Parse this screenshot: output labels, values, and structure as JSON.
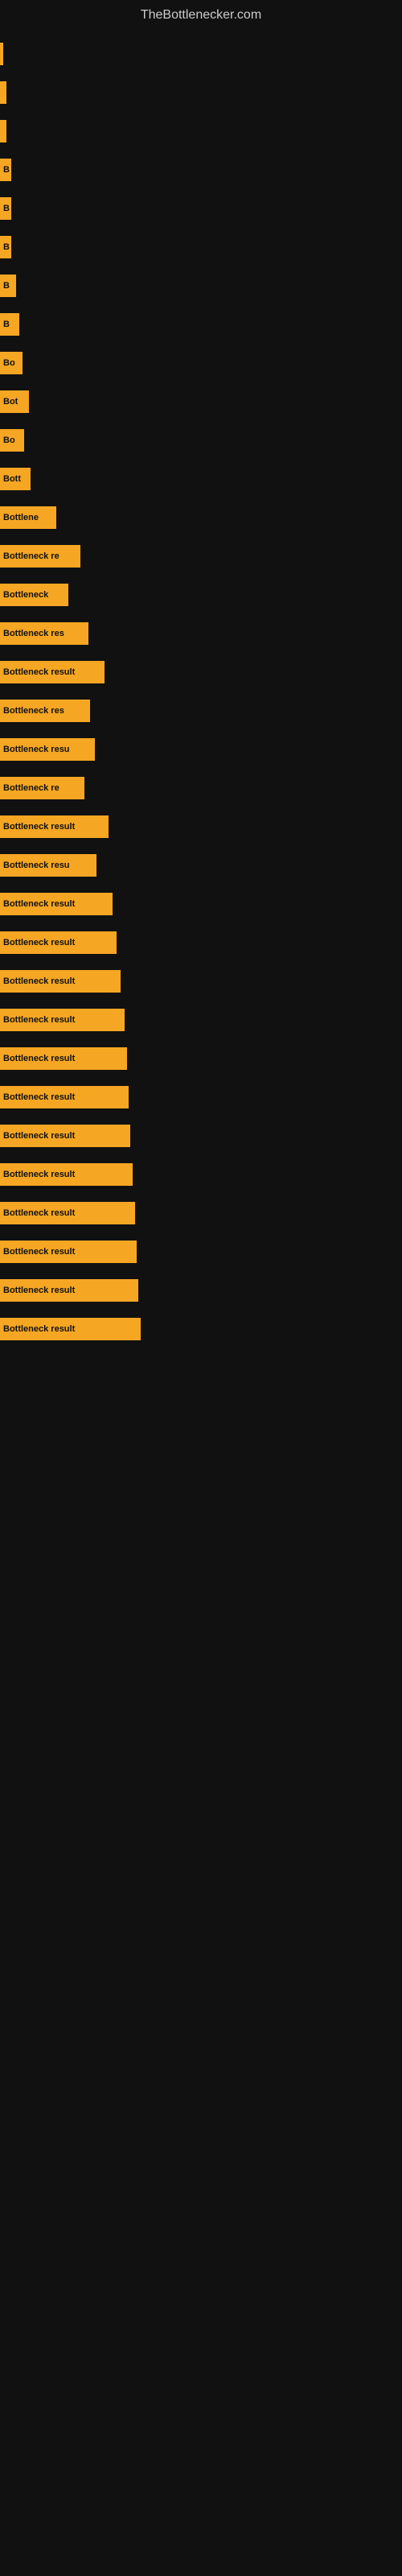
{
  "header": {
    "title": "TheBottlenecker.com"
  },
  "bars": [
    {
      "label": "",
      "width": 4
    },
    {
      "label": "",
      "width": 8
    },
    {
      "label": "",
      "width": 8
    },
    {
      "label": "B",
      "width": 14
    },
    {
      "label": "B",
      "width": 14
    },
    {
      "label": "B",
      "width": 14
    },
    {
      "label": "B",
      "width": 20
    },
    {
      "label": "B",
      "width": 24
    },
    {
      "label": "Bo",
      "width": 28
    },
    {
      "label": "Bot",
      "width": 36
    },
    {
      "label": "Bo",
      "width": 30
    },
    {
      "label": "Bott",
      "width": 38
    },
    {
      "label": "Bottlene",
      "width": 70
    },
    {
      "label": "Bottleneck re",
      "width": 100
    },
    {
      "label": "Bottleneck",
      "width": 85
    },
    {
      "label": "Bottleneck res",
      "width": 110
    },
    {
      "label": "Bottleneck result",
      "width": 130
    },
    {
      "label": "Bottleneck res",
      "width": 112
    },
    {
      "label": "Bottleneck resu",
      "width": 118
    },
    {
      "label": "Bottleneck re",
      "width": 105
    },
    {
      "label": "Bottleneck result",
      "width": 135
    },
    {
      "label": "Bottleneck resu",
      "width": 120
    },
    {
      "label": "Bottleneck result",
      "width": 140
    },
    {
      "label": "Bottleneck result",
      "width": 145
    },
    {
      "label": "Bottleneck result",
      "width": 150
    },
    {
      "label": "Bottleneck result",
      "width": 155
    },
    {
      "label": "Bottleneck result",
      "width": 158
    },
    {
      "label": "Bottleneck result",
      "width": 160
    },
    {
      "label": "Bottleneck result",
      "width": 162
    },
    {
      "label": "Bottleneck result",
      "width": 165
    },
    {
      "label": "Bottleneck result",
      "width": 168
    },
    {
      "label": "Bottleneck result",
      "width": 170
    },
    {
      "label": "Bottleneck result",
      "width": 172
    },
    {
      "label": "Bottleneck result",
      "width": 175
    }
  ]
}
